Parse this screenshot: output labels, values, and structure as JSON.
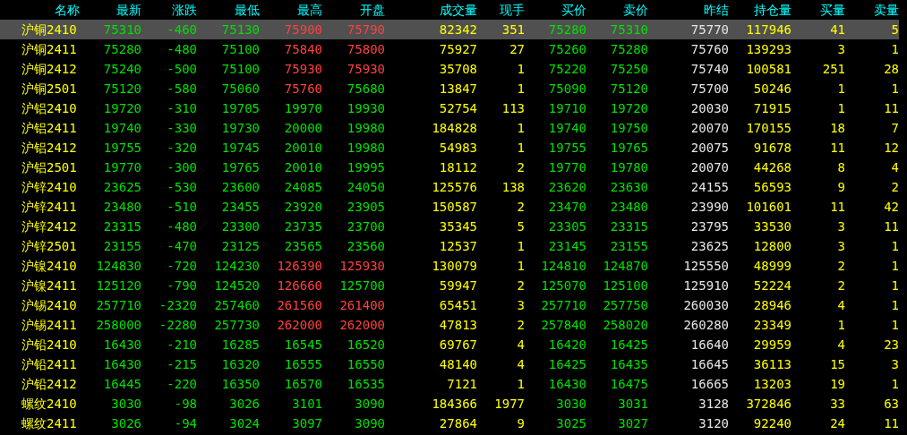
{
  "columns": [
    "名称",
    "最新",
    "涨跌",
    "最低",
    "最高",
    "开盘",
    "成交量",
    "现手",
    "买价",
    "卖价",
    "昨结",
    "持仓量",
    "买量",
    "卖量"
  ],
  "rows": [
    {
      "name": "沪铜2410",
      "selected": true,
      "cells": [
        "75310",
        "-460",
        "75130",
        "75900",
        "75790",
        "82342",
        "351",
        "75280",
        "75310",
        "75770",
        "117946",
        "41",
        "5"
      ]
    },
    {
      "name": "沪铜2411",
      "selected": false,
      "cells": [
        "75280",
        "-480",
        "75100",
        "75840",
        "75800",
        "75927",
        "27",
        "75260",
        "75280",
        "75760",
        "139293",
        "3",
        "1"
      ]
    },
    {
      "name": "沪铜2412",
      "selected": false,
      "cells": [
        "75240",
        "-500",
        "75100",
        "75930",
        "75930",
        "35708",
        "1",
        "75220",
        "75250",
        "75740",
        "100581",
        "251",
        "28"
      ]
    },
    {
      "name": "沪铜2501",
      "selected": false,
      "cells": [
        "75120",
        "-580",
        "75060",
        "75760",
        "75680",
        "13847",
        "1",
        "75090",
        "75120",
        "75700",
        "50246",
        "1",
        "1"
      ]
    },
    {
      "name": "沪铝2410",
      "selected": false,
      "cells": [
        "19720",
        "-310",
        "19705",
        "19970",
        "19930",
        "52754",
        "113",
        "19710",
        "19720",
        "20030",
        "71915",
        "1",
        "11"
      ]
    },
    {
      "name": "沪铝2411",
      "selected": false,
      "cells": [
        "19740",
        "-330",
        "19730",
        "20000",
        "19980",
        "184828",
        "1",
        "19740",
        "19750",
        "20070",
        "170155",
        "18",
        "7"
      ]
    },
    {
      "name": "沪铝2412",
      "selected": false,
      "cells": [
        "19755",
        "-320",
        "19745",
        "20010",
        "19980",
        "54983",
        "1",
        "19755",
        "19765",
        "20075",
        "91678",
        "11",
        "12"
      ]
    },
    {
      "name": "沪铝2501",
      "selected": false,
      "cells": [
        "19770",
        "-300",
        "19765",
        "20010",
        "19995",
        "18112",
        "2",
        "19770",
        "19780",
        "20070",
        "44268",
        "8",
        "4"
      ]
    },
    {
      "name": "沪锌2410",
      "selected": false,
      "cells": [
        "23625",
        "-530",
        "23600",
        "24085",
        "24050",
        "125576",
        "138",
        "23620",
        "23630",
        "24155",
        "56593",
        "9",
        "2"
      ]
    },
    {
      "name": "沪锌2411",
      "selected": false,
      "cells": [
        "23480",
        "-510",
        "23455",
        "23920",
        "23905",
        "150587",
        "2",
        "23470",
        "23480",
        "23990",
        "101601",
        "11",
        "42"
      ]
    },
    {
      "name": "沪锌2412",
      "selected": false,
      "cells": [
        "23315",
        "-480",
        "23300",
        "23735",
        "23700",
        "35345",
        "5",
        "23305",
        "23315",
        "23795",
        "33530",
        "3",
        "11"
      ]
    },
    {
      "name": "沪锌2501",
      "selected": false,
      "cells": [
        "23155",
        "-470",
        "23125",
        "23565",
        "23560",
        "12537",
        "1",
        "23145",
        "23155",
        "23625",
        "12800",
        "3",
        "1"
      ]
    },
    {
      "name": "沪镍2410",
      "selected": false,
      "cells": [
        "124830",
        "-720",
        "124230",
        "126390",
        "125930",
        "130079",
        "1",
        "124810",
        "124870",
        "125550",
        "48999",
        "2",
        "1"
      ]
    },
    {
      "name": "沪镍2411",
      "selected": false,
      "cells": [
        "125120",
        "-790",
        "124520",
        "126660",
        "125700",
        "59947",
        "2",
        "125070",
        "125100",
        "125910",
        "52224",
        "2",
        "1"
      ]
    },
    {
      "name": "沪锡2410",
      "selected": false,
      "cells": [
        "257710",
        "-2320",
        "257460",
        "261560",
        "261400",
        "65451",
        "3",
        "257710",
        "257750",
        "260030",
        "28946",
        "4",
        "1"
      ]
    },
    {
      "name": "沪锡2411",
      "selected": false,
      "cells": [
        "258000",
        "-2280",
        "257730",
        "262000",
        "262000",
        "47813",
        "2",
        "257840",
        "258020",
        "260280",
        "23349",
        "1",
        "1"
      ]
    },
    {
      "name": "沪铅2410",
      "selected": false,
      "cells": [
        "16430",
        "-210",
        "16285",
        "16545",
        "16520",
        "69767",
        "4",
        "16420",
        "16425",
        "16640",
        "29959",
        "4",
        "23"
      ]
    },
    {
      "name": "沪铅2411",
      "selected": false,
      "cells": [
        "16430",
        "-215",
        "16320",
        "16555",
        "16550",
        "48140",
        "4",
        "16425",
        "16435",
        "16645",
        "36113",
        "15",
        "3"
      ]
    },
    {
      "name": "沪铅2412",
      "selected": false,
      "cells": [
        "16445",
        "-220",
        "16350",
        "16570",
        "16535",
        "7121",
        "1",
        "16430",
        "16475",
        "16665",
        "13203",
        "19",
        "1"
      ]
    },
    {
      "name": "螺纹2410",
      "selected": false,
      "cells": [
        "3030",
        "-98",
        "3026",
        "3101",
        "3090",
        "184366",
        "1977",
        "3030",
        "3031",
        "3128",
        "372846",
        "33",
        "63"
      ]
    },
    {
      "name": "螺纹2411",
      "selected": false,
      "cells": [
        "3026",
        "-94",
        "3024",
        "3097",
        "3090",
        "27864",
        "9",
        "3025",
        "3027",
        "3120",
        "92240",
        "24",
        "11"
      ]
    }
  ]
}
